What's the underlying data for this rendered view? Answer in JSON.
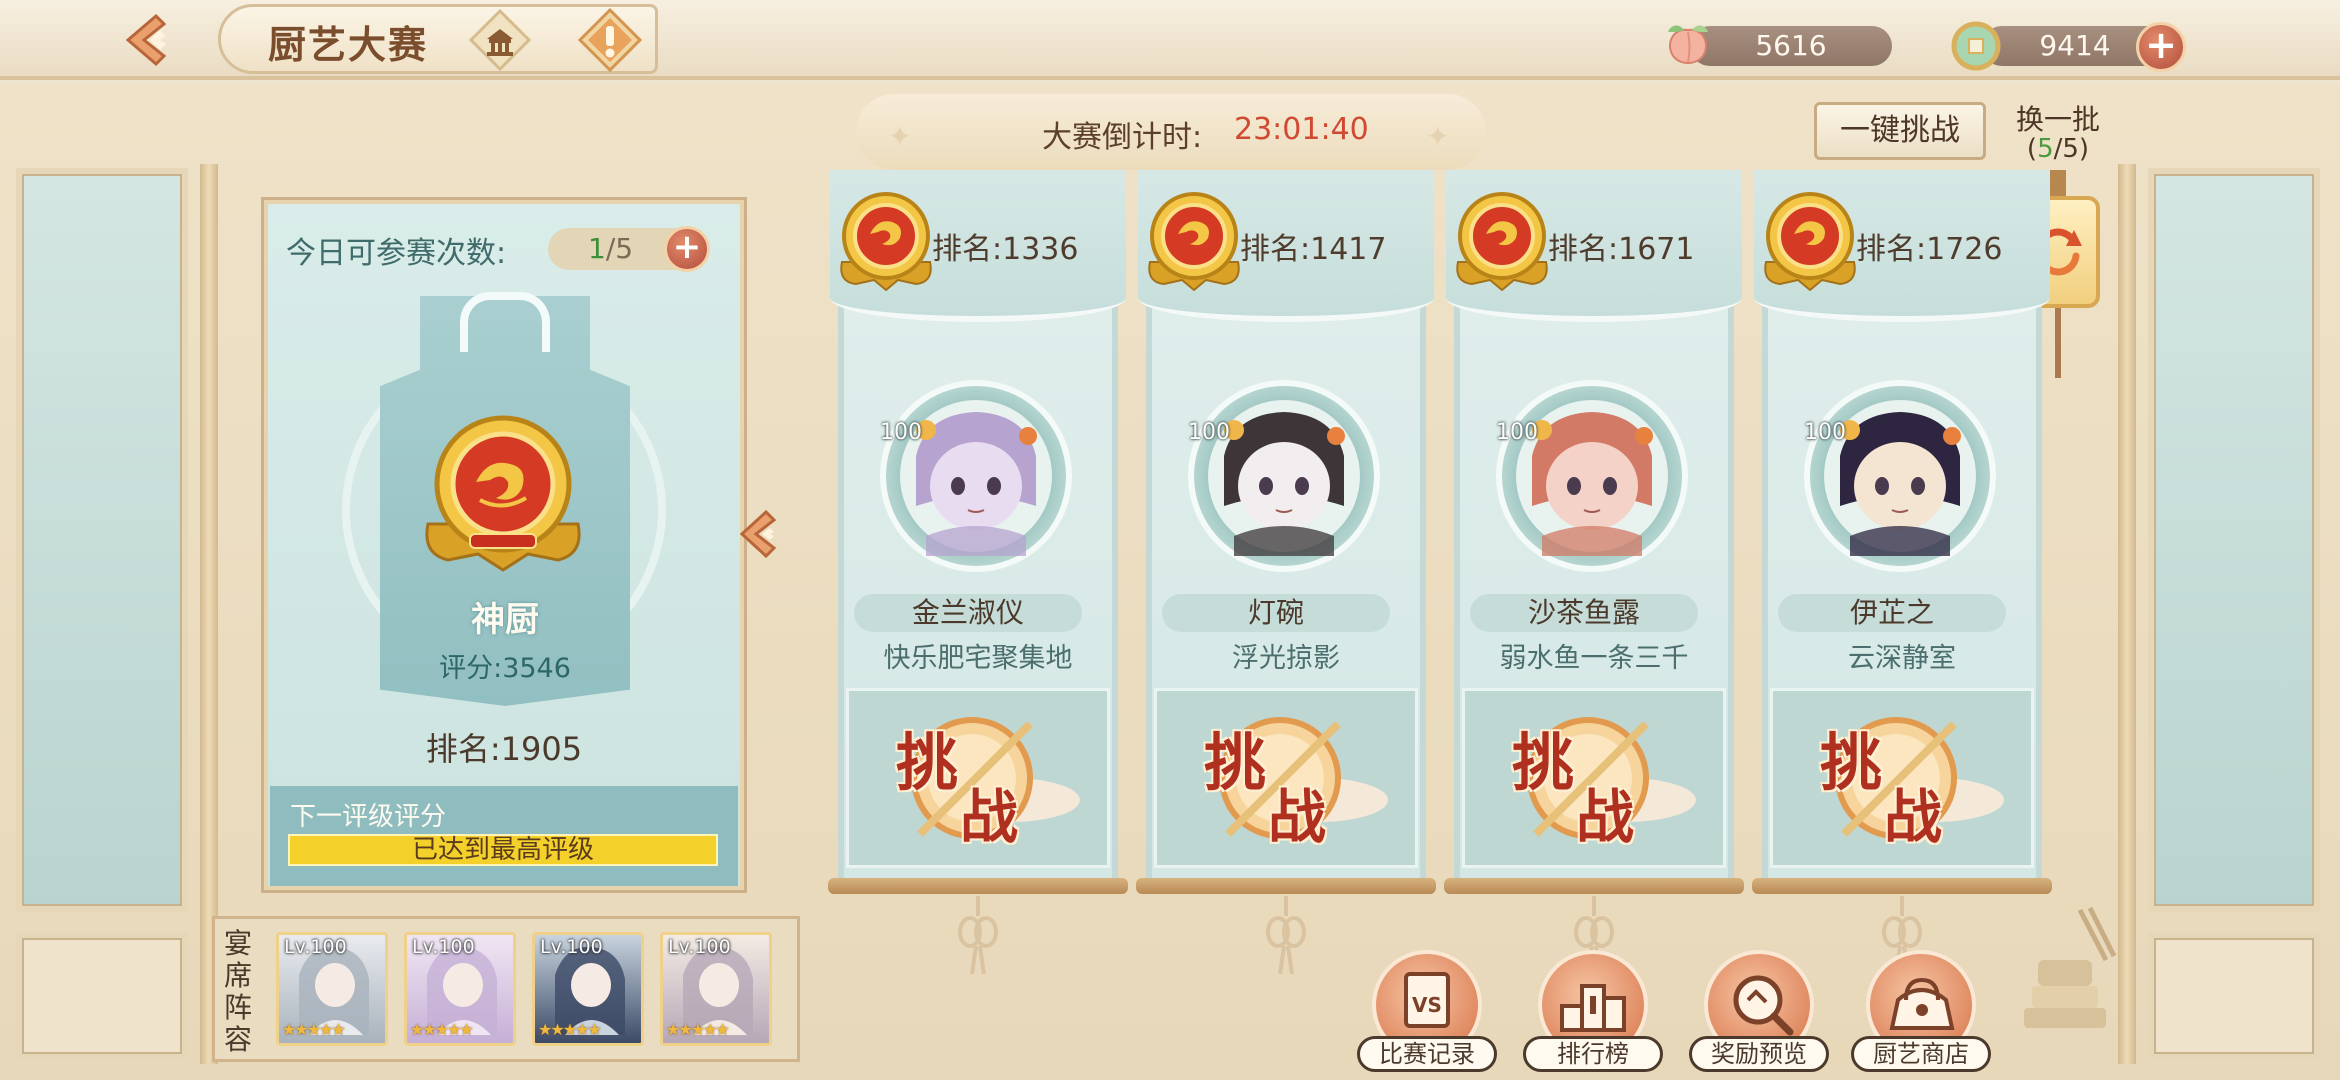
{
  "header": {
    "title": "厨艺大赛",
    "peach_amount": "5616",
    "coin_amount": "9414",
    "plus": "+"
  },
  "contest": {
    "countdown_label": "大赛倒计时:",
    "countdown_time": "23:01:40",
    "one_key_challenge": "一键挑战",
    "refresh_label": "换一批",
    "refresh_count_open": "(",
    "refresh_remaining": "5",
    "refresh_count_rest": "/5)"
  },
  "player": {
    "attempts_label": "今日可参赛次数:",
    "attempts_used": "1",
    "attempts_total": "/5",
    "rank_title": "神厨",
    "score": "评分:3546",
    "rank": "排名:1905",
    "next_grade_label": "下一评级评分",
    "next_grade_value": "已达到最高评级"
  },
  "opponents": [
    {
      "rank": "排名:1336",
      "level": "100",
      "name": "金兰淑仪",
      "guild": "快乐肥宅聚集地",
      "challenge_1": "挑",
      "challenge_2": "战"
    },
    {
      "rank": "排名:1417",
      "level": "100",
      "name": "灯碗",
      "guild": "浮光掠影",
      "challenge_1": "挑",
      "challenge_2": "战"
    },
    {
      "rank": "排名:1671",
      "level": "100",
      "name": "沙茶鱼露",
      "guild": "弱水鱼一条三千",
      "challenge_1": "挑",
      "challenge_2": "战"
    },
    {
      "rank": "排名:1726",
      "level": "100",
      "name": "伊芷之",
      "guild": "云深静室",
      "challenge_1": "挑",
      "challenge_2": "战"
    }
  ],
  "lineup": {
    "label": "宴席阵容",
    "heroes": [
      {
        "level": "Lv.100"
      },
      {
        "level": "Lv.100"
      },
      {
        "level": "Lv.100"
      },
      {
        "level": "Lv.100"
      }
    ]
  },
  "bottom_nav": [
    {
      "label": "比赛记录",
      "icon": "match-record-icon"
    },
    {
      "label": "排行榜",
      "icon": "leaderboard-icon"
    },
    {
      "label": "奖励预览",
      "icon": "reward-preview-icon"
    },
    {
      "label": "厨艺商店",
      "icon": "cooking-shop-icon"
    }
  ],
  "colors": {
    "accent_red": "#d04a32",
    "gold": "#f4d12a",
    "panel_teal": "#d3e7e4"
  }
}
